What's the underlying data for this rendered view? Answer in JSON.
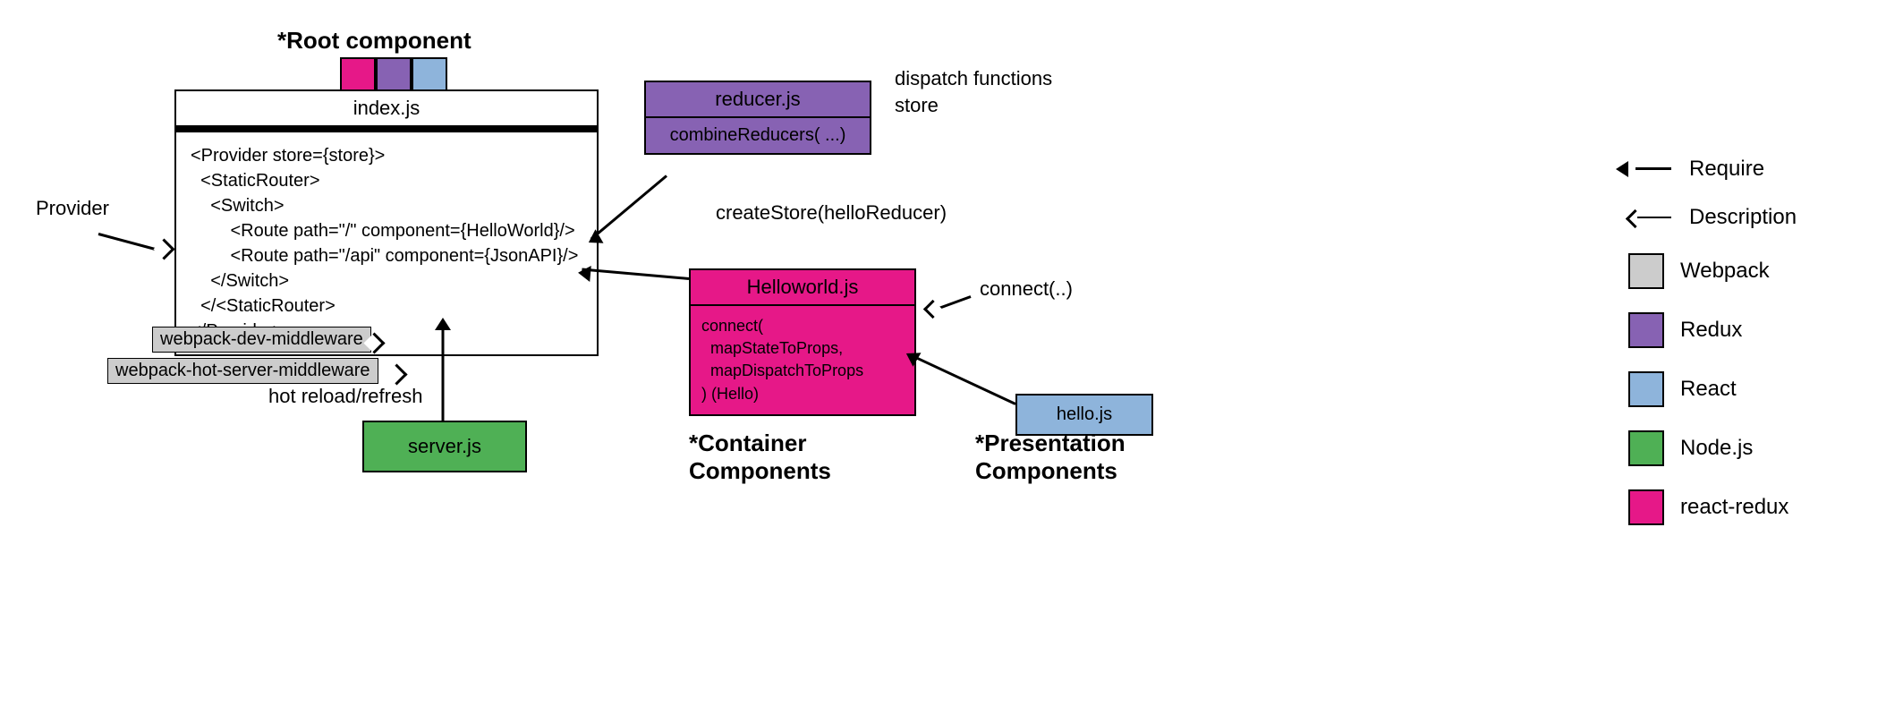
{
  "heading_root": "*Root component",
  "heading_container": "*Container\nComponents",
  "heading_presentation": "*Presentation\nComponents",
  "index_box": {
    "title": "index.js",
    "code": "<Provider store={store}>\n  <StaticRouter>\n    <Switch>\n        <Route path=\"/\" component={HelloWorld}/>\n        <Route path=\"/api\" component={JsonAPI}/>\n    </Switch>\n  </<StaticRouter>\n</Provider>"
  },
  "server_box": {
    "title": "server.js"
  },
  "reducer_box": {
    "title": "reducer.js",
    "body": "combineReducers( ...)"
  },
  "hello_container_box": {
    "title": "Helloworld.js",
    "body": "connect(\n  mapStateToProps,\n  mapDispatchToProps\n) (Hello)"
  },
  "hello_presentation_box": {
    "title": "hello.js"
  },
  "annotations": {
    "provider": "Provider",
    "createStore": "createStore(helloReducer)",
    "dispatchFns": "dispatch functions",
    "store": "store",
    "connect": "connect(..)",
    "hotReload": "hot reload/refresh",
    "webpackDev": "webpack-dev-middleware",
    "webpackHot": "webpack-hot-server-middleware"
  },
  "legend": {
    "require": "Require",
    "description": "Description",
    "webpack": "Webpack",
    "redux": "Redux",
    "react": "React",
    "node": "Node.js",
    "rredux": "react-redux"
  },
  "colors": {
    "webpack": "#cccccc",
    "redux": "#8762b3",
    "react": "#8eb4db",
    "node": "#4fb055",
    "rredux": "#e61888"
  }
}
